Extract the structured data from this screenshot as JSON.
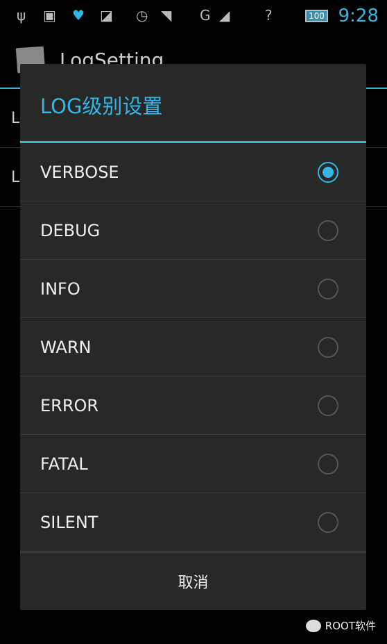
{
  "status_bar": {
    "time": "9:28",
    "battery": "100",
    "network": "G",
    "icons": [
      "usb-icon",
      "android-debug-icon",
      "shield-icon",
      "image-icon",
      "alarm-icon",
      "wifi-icon",
      "signal-icon",
      "sim-unknown-icon",
      "battery-icon"
    ]
  },
  "app": {
    "title": "LogSetting",
    "list_items": [
      "L",
      "L"
    ]
  },
  "dialog": {
    "title": "LOG级别设置",
    "options": [
      {
        "label": "VERBOSE",
        "selected": true
      },
      {
        "label": "DEBUG",
        "selected": false
      },
      {
        "label": "INFO",
        "selected": false
      },
      {
        "label": "WARN",
        "selected": false
      },
      {
        "label": "ERROR",
        "selected": false
      },
      {
        "label": "FATAL",
        "selected": false
      },
      {
        "label": "SILENT",
        "selected": false
      }
    ],
    "cancel_label": "取消"
  },
  "watermark": "ROOT软件",
  "colors": {
    "accent": "#33b5e5",
    "dialog_bg": "#282828"
  }
}
